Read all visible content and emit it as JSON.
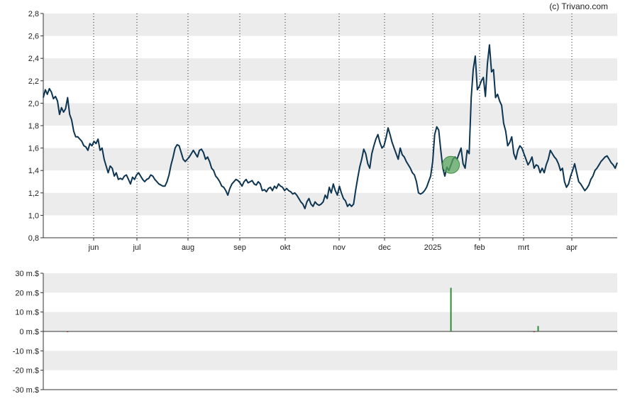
{
  "copyright": "(c) Trivano.com",
  "chart_data": [
    {
      "type": "line",
      "ylim": [
        0.8,
        2.8
      ],
      "yticks": [
        "0,8",
        "1,0",
        "1,2",
        "1,4",
        "1,6",
        "1,8",
        "2,0",
        "2,2",
        "2,4",
        "2,6",
        "2,8"
      ],
      "xlabels": [
        "jun",
        "jul",
        "aug",
        "sep",
        "okt",
        "nov",
        "dec",
        "2025",
        "feb",
        "mrt",
        "apr"
      ],
      "grid": "alternating horizontal bands, dotted vertical month lines",
      "series_color": "#0d3552",
      "marker": {
        "index": 201,
        "color": "#5aa55e"
      },
      "values": [
        2.05,
        2.12,
        2.08,
        2.13,
        2.1,
        2.04,
        2.06,
        2.02,
        1.9,
        1.96,
        1.92,
        1.95,
        2.05,
        1.9,
        1.85,
        1.75,
        1.7,
        1.7,
        1.68,
        1.66,
        1.62,
        1.61,
        1.58,
        1.64,
        1.62,
        1.66,
        1.64,
        1.68,
        1.58,
        1.6,
        1.5,
        1.44,
        1.38,
        1.44,
        1.42,
        1.35,
        1.38,
        1.32,
        1.33,
        1.32,
        1.35,
        1.36,
        1.32,
        1.28,
        1.34,
        1.32,
        1.36,
        1.38,
        1.35,
        1.32,
        1.3,
        1.32,
        1.33,
        1.36,
        1.35,
        1.32,
        1.3,
        1.28,
        1.27,
        1.26,
        1.26,
        1.3,
        1.36,
        1.45,
        1.52,
        1.6,
        1.63,
        1.62,
        1.56,
        1.5,
        1.48,
        1.5,
        1.52,
        1.55,
        1.58,
        1.55,
        1.52,
        1.58,
        1.59,
        1.56,
        1.5,
        1.52,
        1.48,
        1.42,
        1.4,
        1.35,
        1.33,
        1.3,
        1.26,
        1.25,
        1.22,
        1.18,
        1.24,
        1.28,
        1.3,
        1.32,
        1.31,
        1.29,
        1.26,
        1.3,
        1.32,
        1.29,
        1.3,
        1.31,
        1.28,
        1.27,
        1.3,
        1.28,
        1.22,
        1.23,
        1.21,
        1.24,
        1.25,
        1.22,
        1.26,
        1.24,
        1.28,
        1.26,
        1.25,
        1.22,
        1.24,
        1.22,
        1.21,
        1.19,
        1.2,
        1.18,
        1.15,
        1.12,
        1.1,
        1.06,
        1.12,
        1.15,
        1.1,
        1.08,
        1.12,
        1.1,
        1.09,
        1.1,
        1.12,
        1.18,
        1.15,
        1.25,
        1.2,
        1.28,
        1.22,
        1.18,
        1.26,
        1.2,
        1.15,
        1.13,
        1.08,
        1.1,
        1.08,
        1.1,
        1.22,
        1.33,
        1.43,
        1.5,
        1.59,
        1.55,
        1.46,
        1.42,
        1.55,
        1.62,
        1.68,
        1.72,
        1.65,
        1.6,
        1.62,
        1.69,
        1.78,
        1.72,
        1.65,
        1.6,
        1.55,
        1.5,
        1.6,
        1.54,
        1.52,
        1.48,
        1.45,
        1.42,
        1.38,
        1.36,
        1.3,
        1.2,
        1.19,
        1.2,
        1.22,
        1.25,
        1.3,
        1.35,
        1.48,
        1.72,
        1.79,
        1.76,
        1.58,
        1.42,
        1.35,
        1.43,
        1.4,
        1.45,
        1.5,
        1.52,
        1.5,
        1.55,
        1.6,
        1.46,
        1.42,
        1.58,
        1.55,
        2.05,
        2.3,
        2.42,
        2.12,
        2.15,
        2.2,
        2.23,
        2.06,
        2.35,
        2.52,
        2.28,
        2.3,
        2.05,
        2.08,
        2.02,
        1.98,
        1.82,
        1.75,
        1.62,
        1.65,
        1.7,
        1.55,
        1.5,
        1.58,
        1.62,
        1.6,
        1.55,
        1.5,
        1.45,
        1.48,
        1.52,
        1.42,
        1.45,
        1.44,
        1.38,
        1.42,
        1.38,
        1.45,
        1.5,
        1.58,
        1.55,
        1.52,
        1.5,
        1.46,
        1.4,
        1.42,
        1.3,
        1.25,
        1.28,
        1.35,
        1.4,
        1.46,
        1.38,
        1.3,
        1.28,
        1.25,
        1.22,
        1.24,
        1.27,
        1.32,
        1.35,
        1.4,
        1.42,
        1.45,
        1.48,
        1.5,
        1.52,
        1.53,
        1.5,
        1.47,
        1.45,
        1.42,
        1.47
      ]
    },
    {
      "type": "bar",
      "ylim": [
        -30,
        30
      ],
      "yticks": [
        "30 m.$",
        "20 m.$",
        "10 m.$",
        "0 m.$",
        "-10 m.$",
        "-20 m.$",
        "-30 m.$"
      ],
      "bars": [
        {
          "index": 12,
          "value": -0.3,
          "color": "#b22222"
        },
        {
          "index": 201,
          "value": 22.5,
          "color": "#2e8b3a"
        },
        {
          "index": 244,
          "value": 2.8,
          "color": "#2e8b3a"
        },
        {
          "index": 242,
          "value": -0.4,
          "color": "#b22222"
        }
      ]
    }
  ]
}
